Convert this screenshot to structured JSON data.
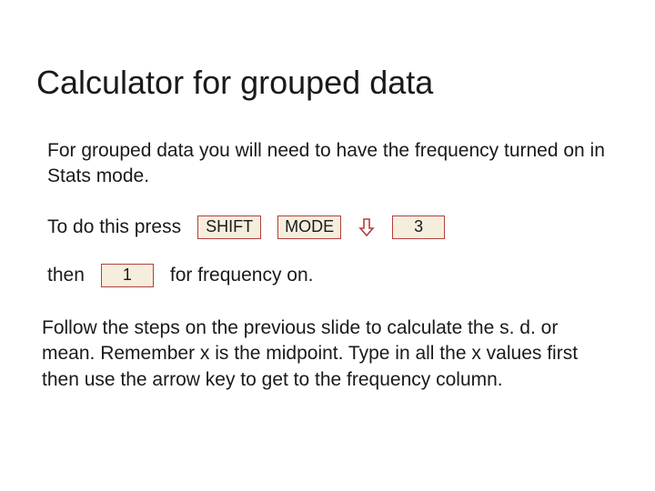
{
  "title": "Calculator for grouped data",
  "para1": "For grouped data you will need to have the frequency turned on in Stats mode.",
  "row1_lead": "To do this press",
  "keys": {
    "shift": "SHIFT",
    "mode": "MODE",
    "three": "3",
    "one": "1"
  },
  "row2_lead": "then",
  "row2_tail": "for frequency on.",
  "para3": "Follow the steps on the previous slide to calculate the s. d. or mean. Remember x is the midpoint. Type in all the x values first then use the arrow key to get to the frequency column."
}
